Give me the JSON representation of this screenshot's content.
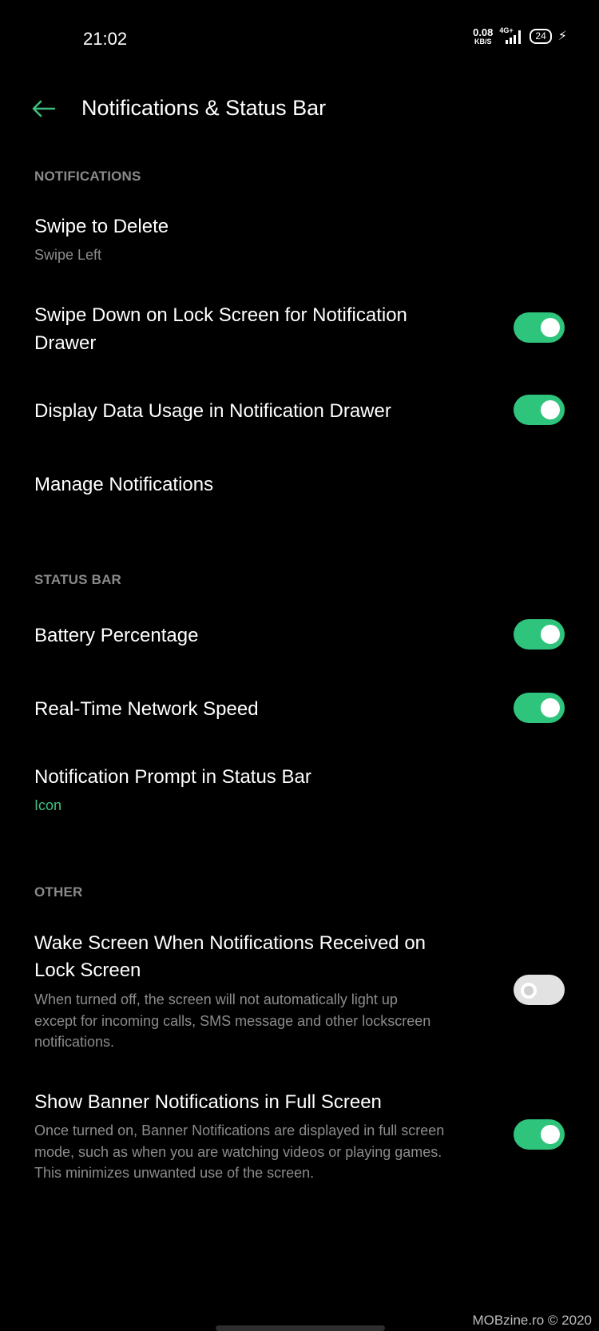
{
  "status_bar": {
    "time": "21:02",
    "net_speed_value": "0.08",
    "net_speed_unit": "KB/S",
    "network_type": "4G+",
    "battery_level": "24",
    "charging_icon": "bolt-icon"
  },
  "header": {
    "back_icon": "arrow-left-icon",
    "title": "Notifications & Status Bar",
    "accent_color": "#3cc080"
  },
  "sections": {
    "notifications": {
      "label": "NOTIFICATIONS",
      "items": [
        {
          "title": "Swipe to Delete",
          "value": "Swipe Left"
        },
        {
          "title": "Swipe Down on Lock Screen for Notification",
          "title_line2": "Drawer",
          "toggle": "on"
        },
        {
          "title": "Display Data Usage in Notification Drawer",
          "toggle": "on"
        },
        {
          "title": "Manage Notifications"
        }
      ]
    },
    "status_bar": {
      "label": "STATUS BAR",
      "items": [
        {
          "title": "Battery Percentage",
          "toggle": "on"
        },
        {
          "title": "Real-Time Network Speed",
          "toggle": "on"
        },
        {
          "title": "Notification Prompt in Status Bar",
          "value": "Icon"
        }
      ]
    },
    "other": {
      "label": "OTHER",
      "items": [
        {
          "title": "Wake Screen When Notifications Received on",
          "title_line2": "Lock Screen",
          "desc_lines": [
            "When turned off, the screen will not automatically light up",
            "except for incoming calls, SMS message and other lockscreen",
            "notifications."
          ],
          "toggle": "off"
        },
        {
          "title": "Show Banner Notifications in Full Screen",
          "desc_lines": [
            "Once turned on, Banner Notifications are displayed in full screen",
            "mode, such as when you are watching videos or playing games.",
            "This minimizes unwanted use of the screen."
          ],
          "toggle": "on"
        }
      ]
    }
  },
  "toggle_colors": {
    "on": "#2fc47c",
    "off": "#e2e2e2"
  },
  "watermark": "MOBzine.ro © 2020"
}
